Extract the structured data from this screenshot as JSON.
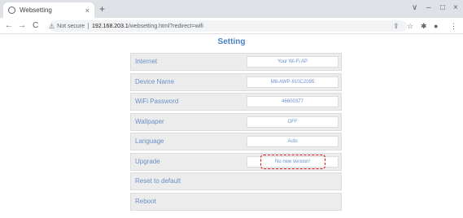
{
  "browser": {
    "tab_title": "Websetting",
    "tab_close": "×",
    "new_tab": "+",
    "window_controls": [
      "∨",
      "–",
      "□",
      "×"
    ],
    "nav": {
      "back": "←",
      "forward": "→",
      "reload": "C"
    },
    "security_icon": "warning-triangle",
    "security_label": "Not secure",
    "url_host": "192.168.203.1",
    "url_path": "/websetting.html?redirect=wifi",
    "toolbar_icons": [
      "share-icon",
      "star-icon",
      "extensions-icon",
      "profile-icon",
      "menu-icon"
    ]
  },
  "page": {
    "title": "Setting",
    "accent_color": "#4a7fc1",
    "highlight_color": "#e0121a",
    "rows": [
      {
        "label": "Internet",
        "value": "Your Wi-Fi AP"
      },
      {
        "label": "Device Name",
        "value": "M8-AWP-910C2095"
      },
      {
        "label": "WiFi Password",
        "value": "46600377"
      },
      {
        "label": "Wallpaper",
        "value": "OFF"
      },
      {
        "label": "Language",
        "value": "Auto"
      },
      {
        "label": "Upgrade",
        "value": "No new version!"
      },
      {
        "label": "Reset to default",
        "value": null
      },
      {
        "label": "Reboot",
        "value": null
      }
    ]
  }
}
